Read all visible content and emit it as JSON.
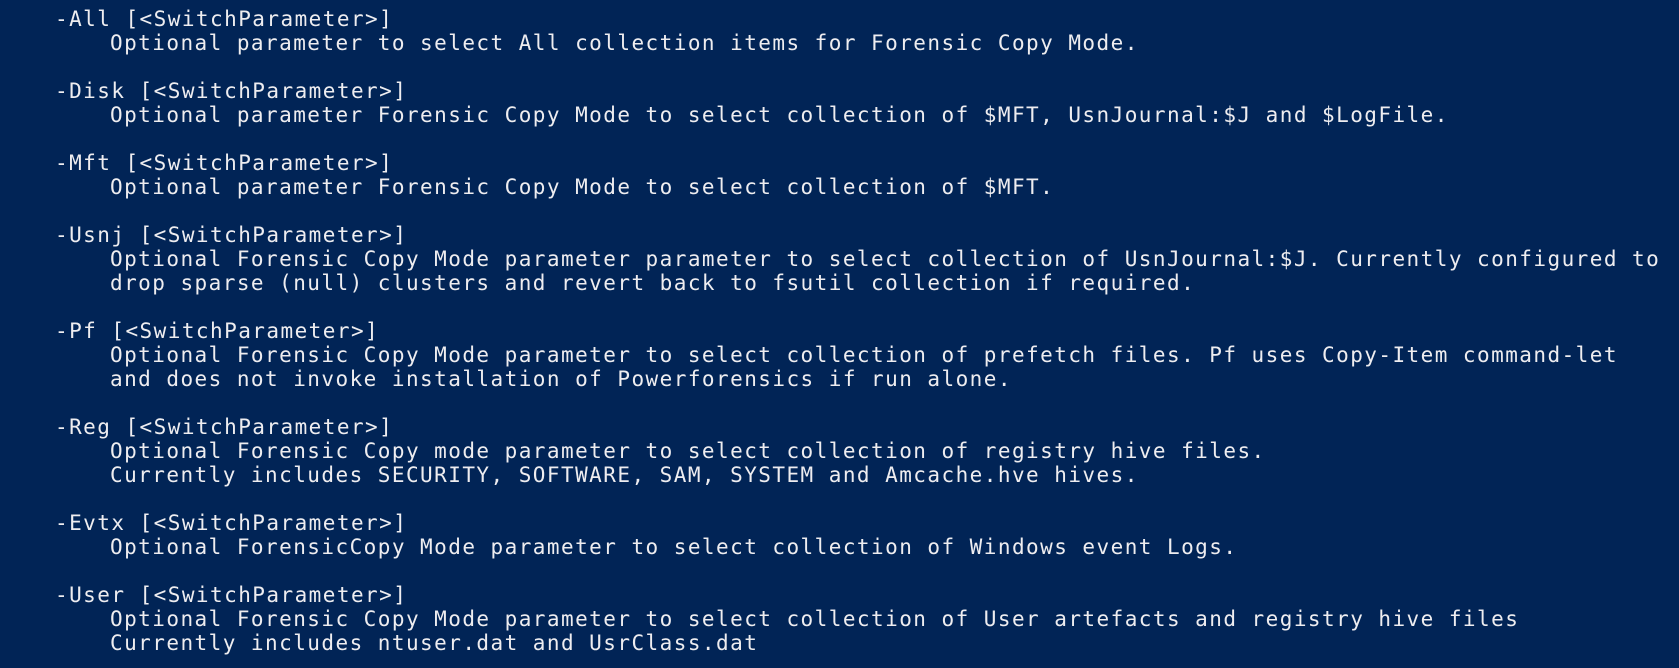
{
  "console": {
    "background": "#012456",
    "foreground": "#eeedf0",
    "parameters": [
      {
        "name": "-All [<SwitchParameter>]",
        "description": [
          "Optional parameter to select All collection items for Forensic Copy Mode."
        ]
      },
      {
        "name": "-Disk [<SwitchParameter>]",
        "description": [
          "Optional parameter Forensic Copy Mode to select collection of $MFT, UsnJournal:$J and $LogFile."
        ]
      },
      {
        "name": "-Mft [<SwitchParameter>]",
        "description": [
          "Optional parameter Forensic Copy Mode to select collection of $MFT."
        ]
      },
      {
        "name": "-Usnj [<SwitchParameter>]",
        "description": [
          "Optional Forensic Copy Mode parameter parameter to select collection of UsnJournal:$J. Currently configured to",
          "drop sparse (null) clusters and revert back to fsutil collection if required."
        ]
      },
      {
        "name": "-Pf [<SwitchParameter>]",
        "description": [
          "Optional Forensic Copy Mode parameter to select collection of prefetch files. Pf uses Copy-Item command-let",
          "and does not invoke installation of Powerforensics if run alone."
        ]
      },
      {
        "name": "-Reg [<SwitchParameter>]",
        "description": [
          "Optional Forensic Copy mode parameter to select collection of registry hive files.",
          "Currently includes SECURITY, SOFTWARE, SAM, SYSTEM and Amcache.hve hives."
        ]
      },
      {
        "name": "-Evtx [<SwitchParameter>]",
        "description": [
          "Optional ForensicCopy Mode parameter to select collection of Windows event Logs."
        ]
      },
      {
        "name": "-User [<SwitchParameter>]",
        "description": [
          "Optional Forensic Copy Mode parameter to select collection of User artefacts and registry hive files",
          "Currently includes ntuser.dat and UsrClass.dat"
        ]
      }
    ]
  }
}
